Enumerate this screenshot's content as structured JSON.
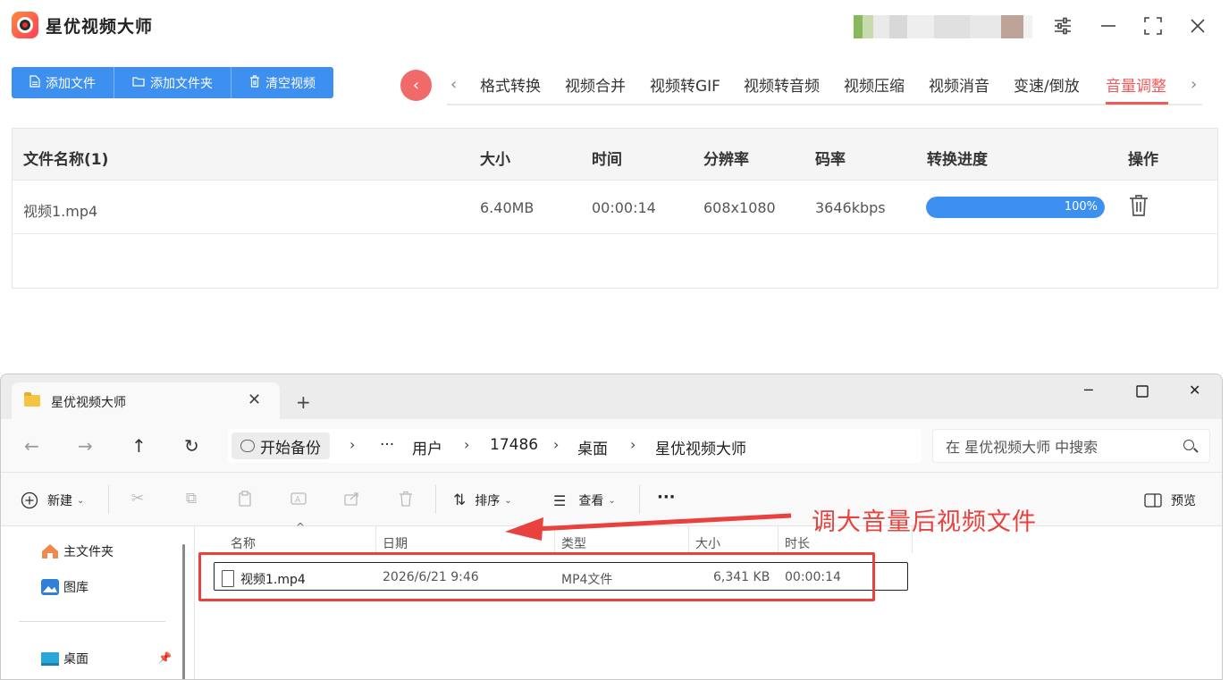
{
  "app": {
    "title": "星优视频大师",
    "accent_color": "#3d8ff0",
    "active_color": "#ef5a5a"
  },
  "toolbar": {
    "add_file": "添加文件",
    "add_folder": "添加文件夹",
    "clear_videos": "清空视频"
  },
  "tabs": [
    {
      "label": "格式转换"
    },
    {
      "label": "视频合并"
    },
    {
      "label": "视频转GIF"
    },
    {
      "label": "视频转音频"
    },
    {
      "label": "视频压缩"
    },
    {
      "label": "视频消音"
    },
    {
      "label": "变速/倒放"
    },
    {
      "label": "音量调整",
      "active": true
    }
  ],
  "table": {
    "headers": {
      "name": "文件名称(1)",
      "size": "大小",
      "time": "时间",
      "resolution": "分辨率",
      "bitrate": "码率",
      "progress": "转换进度",
      "action": "操作"
    },
    "rows": [
      {
        "name": "视频1.mp4",
        "size": "6.40MB",
        "time": "00:00:14",
        "resolution": "608x1080",
        "bitrate": "3646kbps",
        "progress_label": "100%",
        "progress_value": 100
      }
    ]
  },
  "explorer": {
    "tab_title": "星优视频大师",
    "address": {
      "first": "开始备份",
      "ellipsis": "···",
      "crumbs": [
        "用户",
        "17486",
        "桌面",
        "星优视频大师"
      ]
    },
    "search_placeholder": "在 星优视频大师 中搜索",
    "commands": {
      "new": "新建",
      "sort": "排序",
      "view": "查看",
      "more": "···",
      "preview": "预览"
    },
    "sidebar": [
      {
        "label": "主文件夹",
        "icon": "home-icon"
      },
      {
        "label": "图库",
        "icon": "gallery-icon"
      },
      {
        "label": "桌面",
        "icon": "desktop-icon"
      }
    ],
    "columns": {
      "name": "名称",
      "date": "日期",
      "type": "类型",
      "size": "大小",
      "duration": "时长"
    },
    "files": [
      {
        "name": "视频1.mp4",
        "date": "2026/6/21 9:46",
        "type": "MP4文件",
        "size": "6,341 KB",
        "duration": "00:00:14"
      }
    ]
  },
  "annotation": {
    "text": "调大音量后视频文件",
    "color": "#e8413e"
  }
}
